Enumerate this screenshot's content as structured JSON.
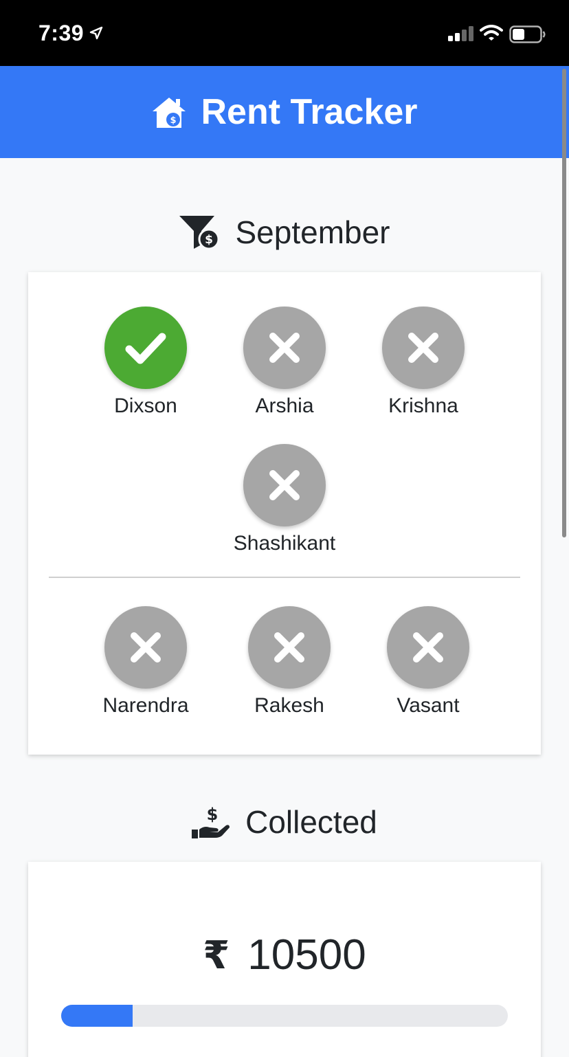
{
  "status_bar": {
    "time": "7:39",
    "icons": [
      "location-arrow-icon",
      "signal-icon",
      "wifi-icon",
      "battery-icon"
    ]
  },
  "header": {
    "title": "Rent Tracker",
    "icon": "house-dollar-icon",
    "background_color": "#3478f6"
  },
  "month_section": {
    "title": "September",
    "icon": "funnel-dollar-icon"
  },
  "tenants": {
    "group_1": [
      {
        "name": "Dixson",
        "paid": true
      },
      {
        "name": "Arshia",
        "paid": false
      },
      {
        "name": "Krishna",
        "paid": false
      },
      {
        "name": "Shashikant",
        "paid": false
      }
    ],
    "group_2": [
      {
        "name": "Narendra",
        "paid": false
      },
      {
        "name": "Rakesh",
        "paid": false
      },
      {
        "name": "Vasant",
        "paid": false
      }
    ],
    "paid_color": "#4caa33",
    "unpaid_color": "#a6a6a6"
  },
  "collected_section": {
    "title": "Collected",
    "icon": "hand-holding-dollar-icon",
    "currency_symbol": "₹",
    "amount": "10500",
    "progress_fraction": 0.16,
    "progress_color": "#3478f6"
  }
}
